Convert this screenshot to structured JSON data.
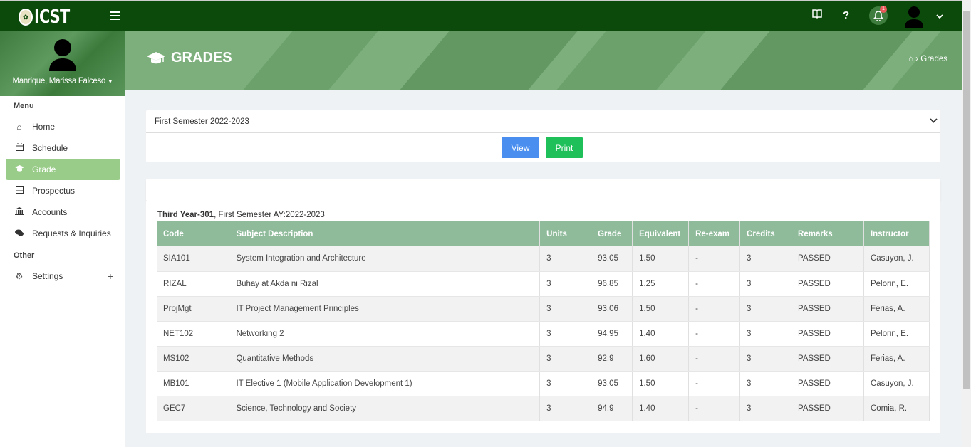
{
  "app": {
    "logo_text": "ICST"
  },
  "topbar": {
    "notification_count": "1"
  },
  "sidebar": {
    "user_name": "Manrique, Marissa Falceso",
    "menu_label": "Menu",
    "other_label": "Other",
    "items": [
      {
        "label": "Home",
        "icon": "home-icon"
      },
      {
        "label": "Schedule",
        "icon": "calendar-icon"
      },
      {
        "label": "Grade",
        "icon": "graduation-cap-icon"
      },
      {
        "label": "Prospectus",
        "icon": "prospectus-icon"
      },
      {
        "label": "Accounts",
        "icon": "bank-icon"
      },
      {
        "label": "Requests & Inquiries",
        "icon": "chat-icon"
      }
    ],
    "settings_label": "Settings"
  },
  "header": {
    "title": "GRADES",
    "breadcrumb": "Grades"
  },
  "filter": {
    "selected_semester": "First Semester 2022-2023",
    "view_label": "View",
    "print_label": "Print"
  },
  "grades": {
    "section": "Third Year-301",
    "semester_text": ", First Semester AY:2022-2023",
    "columns": [
      "Code",
      "Subject Description",
      "Units",
      "Grade",
      "Equivalent",
      "Re-exam",
      "Credits",
      "Remarks",
      "Instructor"
    ],
    "rows": [
      [
        "SIA101",
        "System Integration and Architecture",
        "3",
        "93.05",
        "1.50",
        "-",
        "3",
        "PASSED",
        "Casuyon, J."
      ],
      [
        "RIZAL",
        "Buhay at Akda ni Rizal",
        "3",
        "96.85",
        "1.25",
        "-",
        "3",
        "PASSED",
        "Pelorin, E."
      ],
      [
        "ProjMgt",
        "IT Project Management Principles",
        "3",
        "93.06",
        "1.50",
        "-",
        "3",
        "PASSED",
        "Ferias, A."
      ],
      [
        "NET102",
        "Networking 2",
        "3",
        "94.95",
        "1.40",
        "-",
        "3",
        "PASSED",
        "Pelorin, E."
      ],
      [
        "MS102",
        "Quantitative Methods",
        "3",
        "92.9",
        "1.60",
        "-",
        "3",
        "PASSED",
        "Ferias, A."
      ],
      [
        "MB101",
        "IT Elective 1 (Mobile Application Development 1)",
        "3",
        "93.05",
        "1.50",
        "-",
        "3",
        "PASSED",
        "Casuyon, J."
      ],
      [
        "GEC7",
        "Science, Technology and Society",
        "3",
        "94.9",
        "1.40",
        "-",
        "3",
        "PASSED",
        "Comia, R."
      ]
    ]
  },
  "colors": {
    "topbar": "#0b4a0b",
    "active_nav": "#99cc88",
    "view_button": "#4a8ff0",
    "print_button": "#1fbf5a",
    "table_header": "#8fbb9b"
  }
}
